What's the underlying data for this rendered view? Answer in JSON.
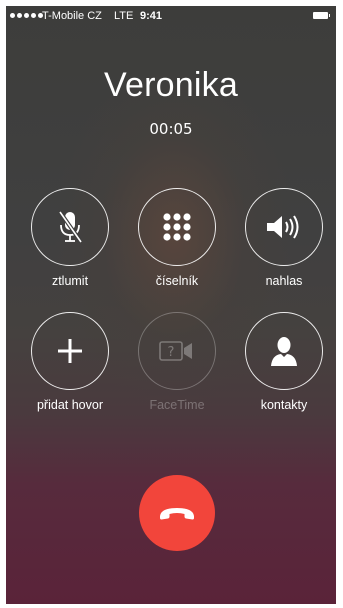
{
  "status_bar": {
    "carrier": "T-Mobile CZ",
    "network": "LTE",
    "time": "9:41",
    "signal_icon": "signal-dots-icon",
    "battery_icon": "battery-icon"
  },
  "call": {
    "caller_name": "Veronika",
    "duration": "00:05"
  },
  "controls": [
    {
      "label": "ztlumit",
      "icon": "microphone-muted-icon",
      "enabled": true
    },
    {
      "label": "číselník",
      "icon": "keypad-icon",
      "enabled": true
    },
    {
      "label": "nahlas",
      "icon": "speaker-icon",
      "enabled": true
    },
    {
      "label": "přidat hovor",
      "icon": "plus-icon",
      "enabled": true
    },
    {
      "label": "FaceTime",
      "icon": "facetime-icon",
      "enabled": false
    },
    {
      "label": "kontakty",
      "icon": "contact-icon",
      "enabled": true
    }
  ],
  "end_call": {
    "icon": "end-call-icon"
  },
  "colors": {
    "end_call": "#f2453b",
    "text": "#ffffff"
  }
}
